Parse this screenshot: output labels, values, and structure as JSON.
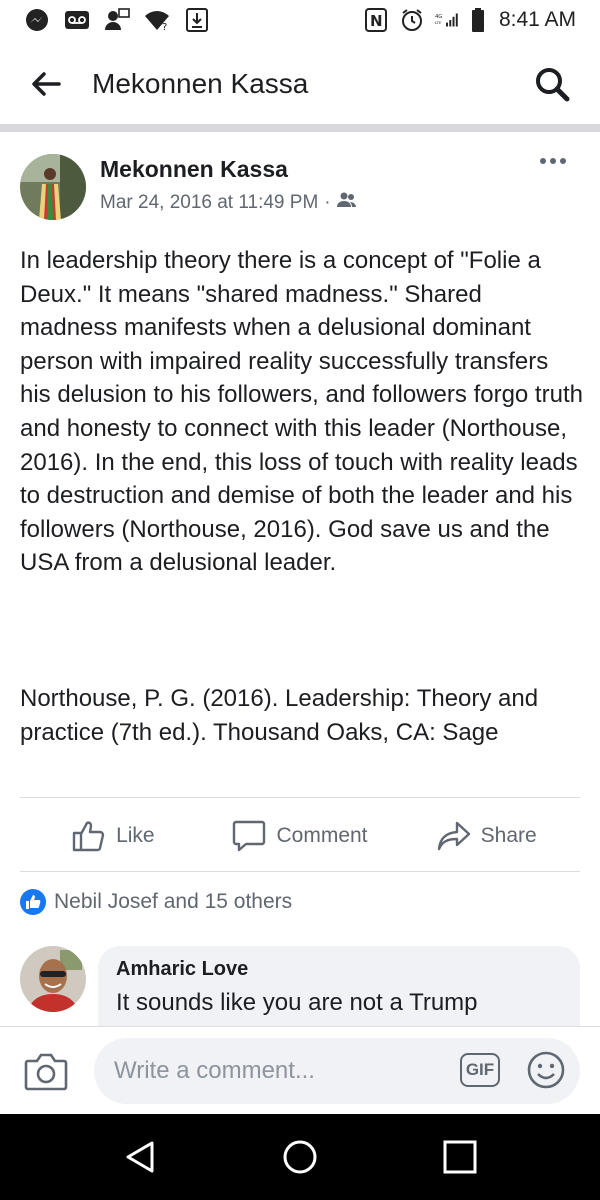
{
  "status_bar": {
    "time": "8:41 AM",
    "icons": [
      "messenger-icon",
      "voicemail-icon",
      "contacts-icon",
      "wifi-question-icon",
      "download-icon",
      "nfc-icon",
      "alarm-icon",
      "lte-signal-icon",
      "battery-icon"
    ],
    "network": "4G"
  },
  "header": {
    "title": "Mekonnen Kassa"
  },
  "post": {
    "author": "Mekonnen Kassa",
    "timestamp": "Mar 24, 2016 at 11:49 PM",
    "separator": "·",
    "body": "In leadership theory there is a concept of \"Folie a Deux.\" It means \"shared madness.\" Shared madness manifests when a delusional dominant person with impaired reality successfully transfers his delusion to his followers, and followers forgo truth and honesty to connect with this leader (Northouse, 2016). In the end, this loss of touch with reality leads to destruction and demise of both the leader and his followers (Northouse, 2016). God save us and the USA from a delusional leader.",
    "reference": "Northouse, P. G. (2016). Leadership: Theory and practice (7th ed.). Thousand Oaks, CA: Sage"
  },
  "actions": {
    "like": "Like",
    "comment": "Comment",
    "share": "Share"
  },
  "reactions": {
    "summary": "Nebil Josef and 15 others"
  },
  "comment": {
    "author": "Amharic Love",
    "text": "It sounds like you are not a Trump"
  },
  "composer": {
    "placeholder": "Write a comment...",
    "gif_label": "GIF"
  },
  "colors": {
    "brand": "#1877f2",
    "text": "#1c1e21",
    "secondary": "#606770",
    "bubble": "#f0f2f5"
  }
}
